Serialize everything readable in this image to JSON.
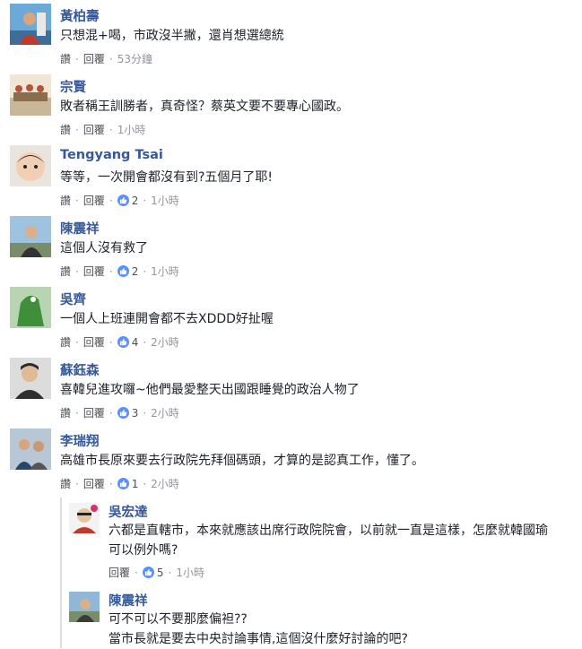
{
  "actions": {
    "like": "讚",
    "reply": "回覆"
  },
  "comments": [
    {
      "author": "黃柏壽",
      "text": "只想混+喝，市政沒半撇，還肖想選總統",
      "reactions": "",
      "time": "53分鐘"
    },
    {
      "author": "宗賢",
      "text": "敗者稱王訓勝者，真奇怪？蔡英文要不要專心國政。",
      "reactions": "",
      "time": "1小時"
    },
    {
      "author": "Tengyang Tsai",
      "text": "等等，一次開會都沒有到?五個月了耶!",
      "reactions": "2",
      "time": "1小時"
    },
    {
      "author": "陳震祥",
      "text": "這個人沒有救了",
      "reactions": "2",
      "time": "1小時"
    },
    {
      "author": "吳齊",
      "text": "一個人上班連開會都不去XDDD好扯喔",
      "reactions": "4",
      "time": "2小時"
    },
    {
      "author": "蘇鈺森",
      "text": "喜韓兒進攻囉~他們最愛整天出國跟睡覺的政治人物了",
      "reactions": "3",
      "time": "2小時"
    },
    {
      "author": "李瑞翔",
      "text": "高雄市長原來要去行政院先拜個碼頭，才算的是認真工作，懂了。",
      "reactions": "1",
      "time": "2小時"
    }
  ],
  "replies": [
    {
      "author": "吳宏達",
      "text_line1": "六都是直轄市，本來就應該出席行政院院會，以前就一直是這樣，怎麼就韓國瑜",
      "text_line2": "可以例外嗎?",
      "reactions": "5",
      "time": "1小時"
    },
    {
      "author": "陳震祥",
      "text_line1": "可不可以不要那麼偏袒??",
      "text_line2": "當市長就是要去中央討論事情,這個沒什麼好討論的吧?"
    }
  ],
  "colors": {
    "name": "#365899",
    "text": "#1d2129",
    "meta": "#90949c",
    "like": "#5890ff"
  },
  "icons": {
    "reaction": "thumbs-up-icon"
  }
}
